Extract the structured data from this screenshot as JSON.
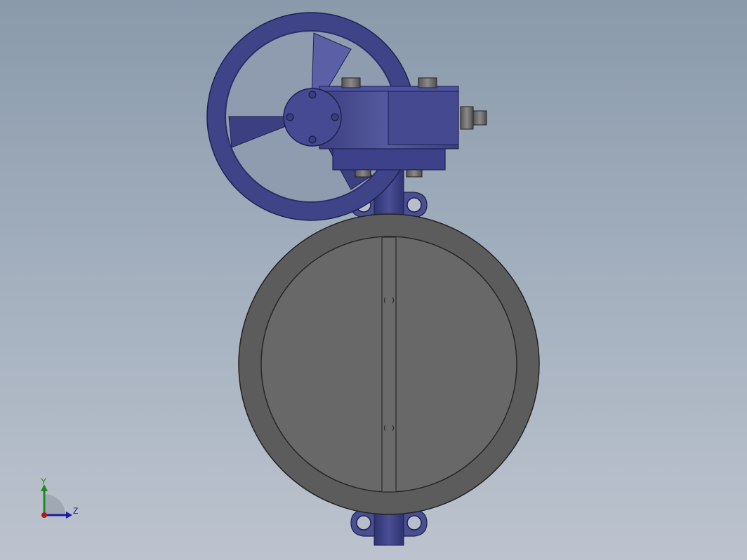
{
  "triad": {
    "y_label": "Y",
    "z_label": "Z",
    "colors": {
      "y_axis": "#1f8a1f",
      "z_axis": "#1a1aa8",
      "origin": "#b01a1a"
    }
  },
  "colors": {
    "background_top": "#8a9aab",
    "background_bottom": "#bcc3ce",
    "gearbox": "#4a4f8f",
    "valve_body": "#5a5a5a",
    "disc": "#676767"
  }
}
